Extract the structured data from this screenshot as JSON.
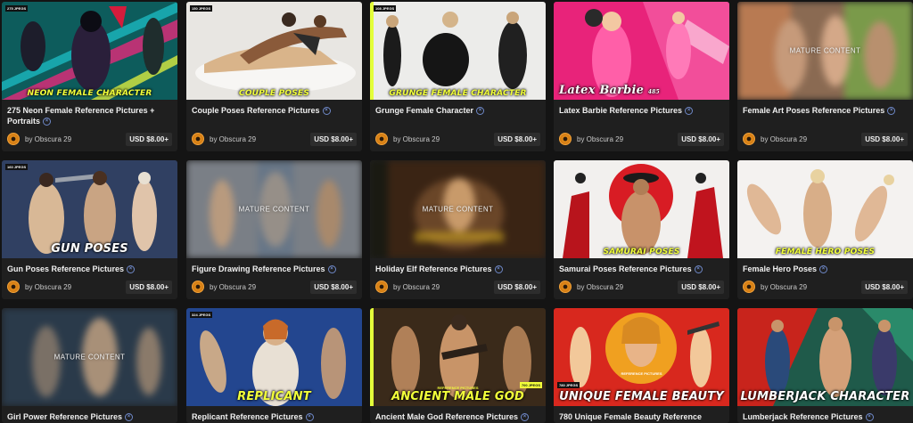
{
  "cards": [
    {
      "title": "275 Neon Female Reference Pictures + Portraits",
      "caption": "NEON FEMALE CHARACTER",
      "by": "by Obscura 29",
      "price": "USD $8.00+",
      "mature": "",
      "badge": "275 JPEGS"
    },
    {
      "title": "Couple Poses Reference Pictures",
      "caption": "COUPLE POSES",
      "by": "by Obscura 29",
      "price": "USD $8.00+",
      "mature": "",
      "badge": "150 JPEGS"
    },
    {
      "title": "Grunge Female Character",
      "caption": "GRUNGE FEMALE CHARACTER",
      "by": "by Obscura 29",
      "price": "USD $8.00+",
      "mature": "",
      "badge": "108 JPEGS"
    },
    {
      "title": "Latex Barbie Reference Pictures",
      "caption": "Latex Barbie",
      "by": "by Obscura 29",
      "price": "USD $8.00+",
      "mature": "",
      "badge": "",
      "caption_number": "485"
    },
    {
      "title": "Female Art Poses Reference Pictures",
      "caption": "",
      "by": "by Obscura 29",
      "price": "USD $8.00+",
      "mature": "MATURE CONTENT",
      "badge": ""
    },
    {
      "title": "Gun Poses Reference Pictures",
      "caption": "GUN POSES",
      "by": "by Obscura 29",
      "price": "USD $8.00+",
      "mature": "",
      "badge": "160 JPEGS"
    },
    {
      "title": "Figure Drawing Reference Pictures",
      "caption": "",
      "by": "by Obscura 29",
      "price": "USD $8.00+",
      "mature": "MATURE CONTENT",
      "badge": ""
    },
    {
      "title": "Holiday Elf Reference Pictures",
      "caption": "",
      "by": "by Obscura 29",
      "price": "USD $8.00+",
      "mature": "MATURE CONTENT",
      "badge": ""
    },
    {
      "title": "Samurai Poses Reference Pictures",
      "caption": "SAMURAI POSES",
      "by": "by Obscura 29",
      "price": "USD $8.00+",
      "mature": "",
      "badge": ""
    },
    {
      "title": "Female Hero Poses",
      "caption": "FEMALE HERO POSES",
      "by": "by Obscura 29",
      "price": "USD $8.00+",
      "mature": "",
      "badge": ""
    },
    {
      "title": "Girl Power Reference Pictures",
      "caption": "",
      "by": "",
      "price": "",
      "mature": "MATURE CONTENT",
      "badge": ""
    },
    {
      "title": "Replicant Reference Pictures",
      "caption": "REPLICANT",
      "by": "",
      "price": "",
      "mature": "",
      "badge": "324 JPEGS"
    },
    {
      "title": "Ancient Male God Reference Pictures",
      "caption": "ANCIENT MALE GOD",
      "by": "",
      "price": "",
      "mature": "",
      "badge": "",
      "overline": "REFERENCE PICTURES",
      "side_badge": "700 JPEGS"
    },
    {
      "title": "780 Unique Female Beauty Reference",
      "caption": "UNIQUE FEMALE BEAUTY",
      "by": "",
      "price": "",
      "mature": "",
      "badge": "780 JPEGS",
      "overline": "REFERENCE PICTURES"
    },
    {
      "title": "Lumberjack Reference Pictures",
      "caption": "LUMBERJACK CHARACTER",
      "by": "",
      "price": "",
      "mature": "",
      "badge": ""
    }
  ],
  "icons": {
    "info": "info-circle-icon",
    "avatar": "creator-avatar-icon"
  },
  "info_glyph": "×"
}
